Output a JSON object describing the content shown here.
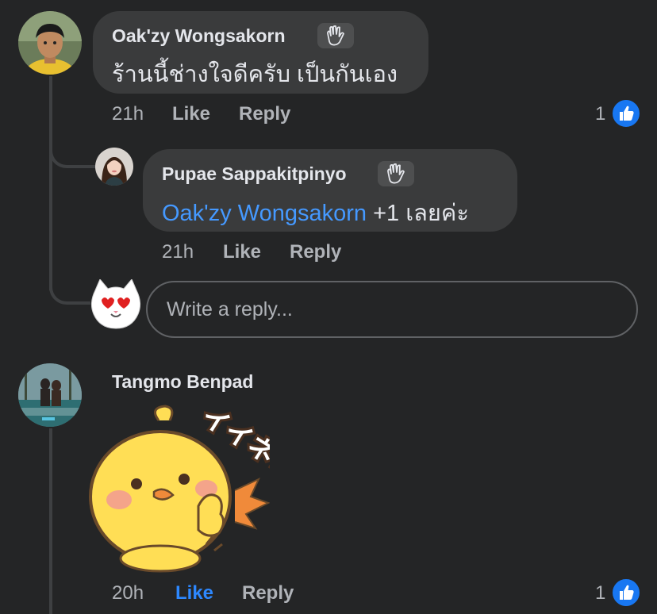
{
  "comments": [
    {
      "author": "Oak'zy Wongsakorn",
      "badge_icon": "waving-hand-icon",
      "text": "ร้านนี้ช่างใจดีครับ เป็นกันเอง",
      "time": "21h",
      "like_label": "Like",
      "reply_label": "Reply",
      "reaction_count": "1",
      "reaction_icon": "like-icon"
    },
    {
      "author": "Tangmo Benpad",
      "sticker": "chick-sticker",
      "time": "20h",
      "like_label": "Like",
      "liked": true,
      "reply_label": "Reply",
      "reaction_count": "1",
      "reaction_icon": "like-icon"
    }
  ],
  "reply": {
    "author": "Pupae Sappakitpinyo",
    "badge_icon": "waving-hand-icon",
    "mention": "Oak'zy Wongsakorn",
    "text": " +1 เลยค่ะ",
    "time": "21h",
    "like_label": "Like",
    "reply_label": "Reply"
  },
  "reply_box": {
    "placeholder": "Write a reply...",
    "avatar_icon": "heart-eyes-cat-avatar"
  },
  "colors": {
    "background": "#242526",
    "bubble": "#3a3b3c",
    "mention": "#4599ff",
    "like_active": "#2d88ff",
    "reaction_blue": "#1877f2"
  }
}
